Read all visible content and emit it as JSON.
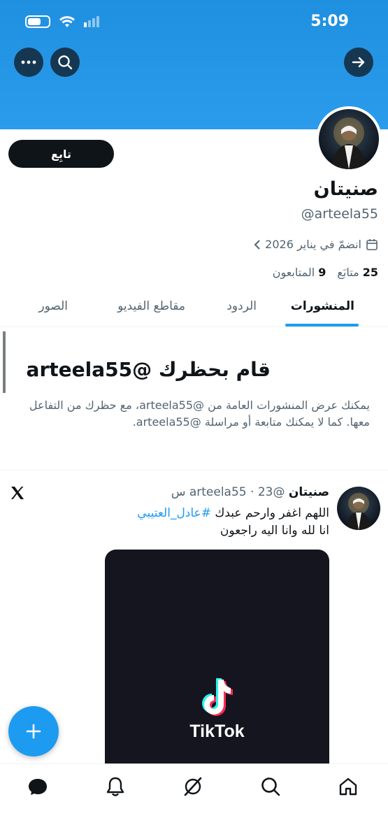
{
  "status_bar": {
    "time": "5:09"
  },
  "profile": {
    "name": "صنيتان",
    "handle": "@arteela55",
    "joined": "انضمّ في يناير 2026",
    "following_count": "25",
    "following_label": "متابَع",
    "followers_count": "9",
    "followers_label": "المتابعون",
    "follow_button": "تابِع"
  },
  "tabs": [
    {
      "label": "المنشورات",
      "active": true
    },
    {
      "label": "الردود",
      "active": false
    },
    {
      "label": "مقاطع الفيديو",
      "active": false
    },
    {
      "label": "الصور",
      "active": false
    }
  ],
  "blocked": {
    "title": "قام بحظرك @arteela55",
    "description": "يمكنك عرض المنشورات العامة من @arteela55، مع حظرك من التفاعل معها. كما لا يمكنك متابعة أو مراسلة @arteela55."
  },
  "tweet": {
    "name": "صنيتان",
    "meta": "@arteela55 · 23 س",
    "line1_text": "اللهم اغفر وارحم عبدك ",
    "hashtag": "#عادل_العتيبي",
    "line2": "انا  لله وانا اليه راجعون",
    "media_label": "TikTok"
  },
  "icons": {
    "back": "arrow-right-icon",
    "more": "more-icon",
    "search": "search-icon",
    "compose": "plus-icon",
    "nav": [
      "home-icon",
      "search-icon",
      "grok-icon",
      "notifications-icon",
      "messages-icon"
    ]
  },
  "colors": {
    "accent": "#1d9bf0",
    "banner": "#2b9bec",
    "text": "#0f1419",
    "muted": "#536471"
  }
}
